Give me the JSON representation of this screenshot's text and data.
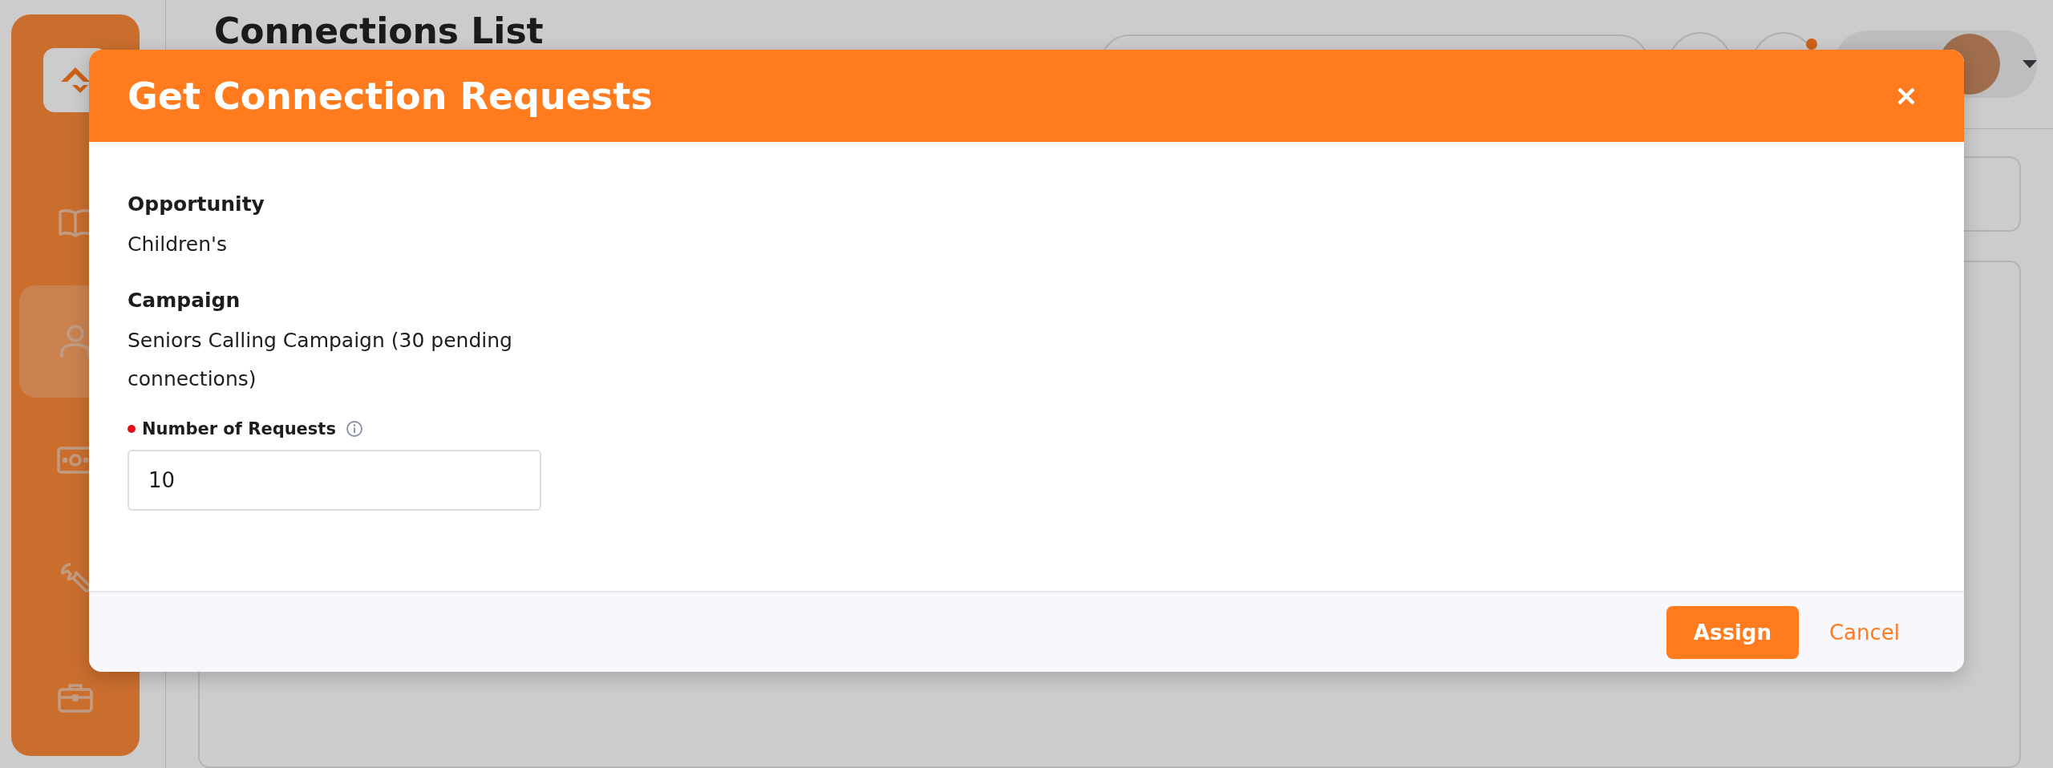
{
  "page": {
    "title": "Connections List"
  },
  "sidebar": {
    "items": [
      {
        "kind": "book",
        "selected": false
      },
      {
        "kind": "person",
        "selected": true
      },
      {
        "kind": "money",
        "selected": false
      },
      {
        "kind": "wrench",
        "selected": false
      },
      {
        "kind": "briefcase",
        "selected": false
      }
    ]
  },
  "header": {
    "notification": true
  },
  "modal": {
    "title": "Get Connection Requests",
    "details": [
      {
        "label": "Opportunity",
        "value": "Children's"
      },
      {
        "label": "Campaign",
        "value": "Seniors Calling Campaign (30 pending connections)"
      }
    ],
    "number_field": {
      "label": "Number of Requests",
      "required": true,
      "value": "10"
    },
    "buttons": [
      {
        "label": "Assign",
        "kind": "primary"
      },
      {
        "label": "Cancel",
        "kind": "link"
      }
    ]
  }
}
